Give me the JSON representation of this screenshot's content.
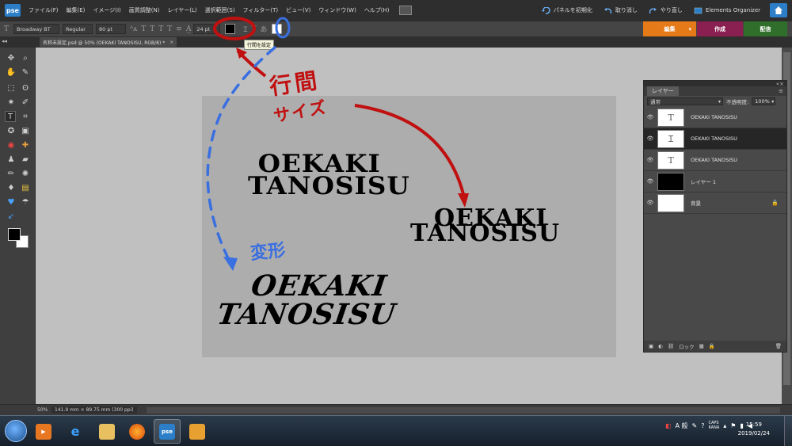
{
  "app": {
    "logo": "pse"
  },
  "menu": {
    "items": [
      "ファイル(F)",
      "編集(E)",
      "イメージ(I)",
      "画質調整(N)",
      "レイヤー(L)",
      "選択範囲(S)",
      "フィルター(T)",
      "ビュー(V)",
      "ウィンドウ(W)",
      "ヘルプ(H)"
    ],
    "reset_panels": "パネルを初期化",
    "undo": "取り消し",
    "redo": "やり直し",
    "organizer": "Elements Organizer"
  },
  "options": {
    "font_family": "Broadway BT",
    "font_style": "Regular",
    "font_size": "80 pt",
    "leading_value": "24 pt",
    "tooltip": "行間を設定"
  },
  "workspace_tabs": {
    "edit": "編集",
    "create": "作成",
    "share": "配信"
  },
  "document": {
    "tab_title": "名称未設定.psd @ 50% (OEKAKI TANOSISU, RGB/8) *",
    "tab_close": "×"
  },
  "canvas_texts": [
    {
      "line1": "OEKAKI",
      "line2": "TANOSISU"
    },
    {
      "line1": "OEKAKI",
      "line2": "TANOSISU"
    },
    {
      "line1": "OEKAKI",
      "line2": "TANOSISU"
    }
  ],
  "annotations": {
    "red_label_1": "行間",
    "red_label_2": "サイズ",
    "blue_label": "変形",
    "red_color": "#c01010",
    "blue_color": "#3a6fe0"
  },
  "layers_panel": {
    "title": "レイヤー",
    "blend_mode": "通常",
    "opacity_label": "不透明度:",
    "opacity_value": "100%",
    "layers": [
      {
        "name": "OEKAKI TANOSISU",
        "thumb": "T",
        "selected": false
      },
      {
        "name": "OEKAKI TANOSISU",
        "thumb": "Ɪ",
        "selected": true
      },
      {
        "name": "OEKAKI TANOSISU",
        "thumb": "T",
        "selected": false
      },
      {
        "name": "レイヤー 1",
        "thumb": "",
        "selected": false
      },
      {
        "name": "背景",
        "thumb": "",
        "selected": false
      }
    ],
    "lock_label": "ロック"
  },
  "status": {
    "zoom": "50%",
    "doc_info": "141.9 mm × 89.75 mm (300 ppi)"
  },
  "taskbar": {
    "tray_text": "A 般",
    "caps": "CAPS",
    "kana": "KANA",
    "time": "15:59",
    "date": "2019/02/24"
  }
}
